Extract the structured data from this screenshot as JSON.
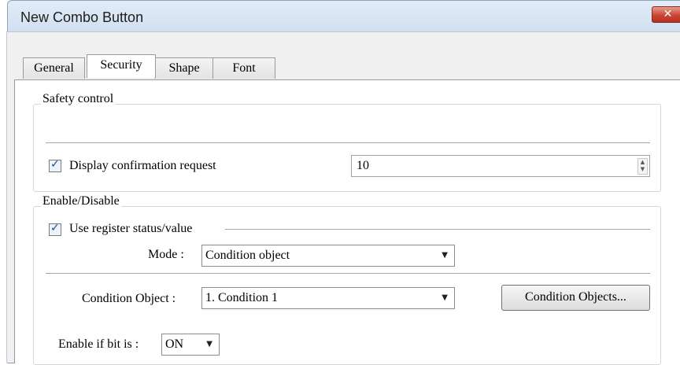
{
  "window": {
    "title": "New Combo Button",
    "close_label": "✕"
  },
  "tabs": [
    {
      "label": "General"
    },
    {
      "label": "Security"
    },
    {
      "label": "Shape"
    },
    {
      "label": "Font"
    }
  ],
  "safety": {
    "title": "Safety control",
    "confirm_label": "Display confirmation request",
    "confirm_checked": true,
    "confirm_value": "10"
  },
  "enable": {
    "title": "Enable/Disable",
    "use_register_label": "Use register status/value",
    "use_register_checked": true,
    "mode_label": "Mode :",
    "mode_value": "Condition object",
    "condition_object_label": "Condition Object :",
    "condition_object_value": "1. Condition 1",
    "condition_objects_button": "Condition Objects...",
    "enable_bit_label": "Enable if bit is :",
    "enable_bit_value": "ON"
  },
  "colors": {
    "close_button": "#c94634",
    "checkbox_mark": "#2a4d83"
  }
}
